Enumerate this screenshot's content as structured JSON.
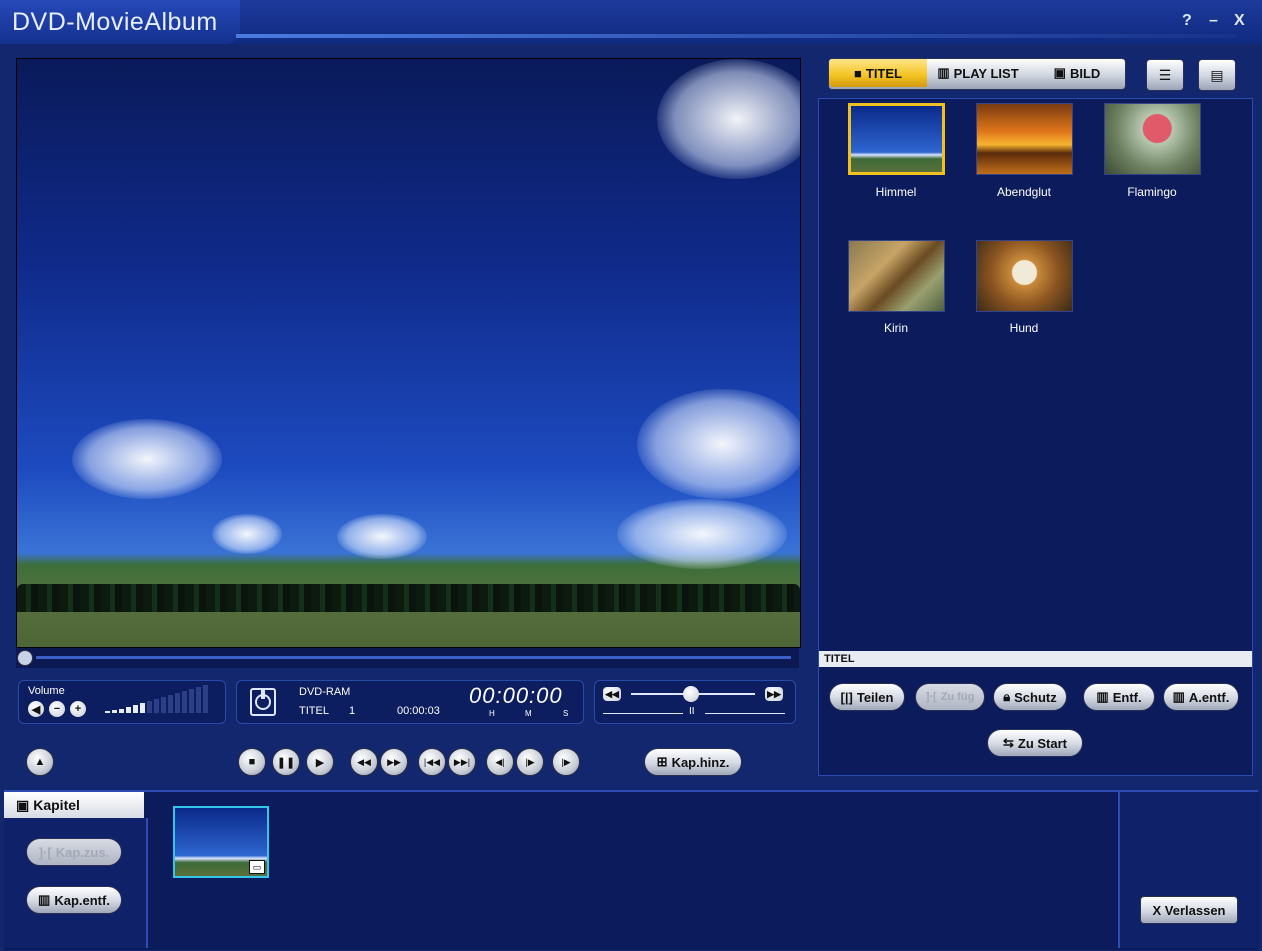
{
  "window": {
    "title": "DVD-MovieAlbum",
    "help": "?",
    "minimize": "–",
    "close": "X"
  },
  "tabs": {
    "titel": "TITEL",
    "playlist": "PLAY LIST",
    "bild": "BILD"
  },
  "thumbnails": [
    {
      "label": "Himmel",
      "selected": true
    },
    {
      "label": "Abendglut",
      "selected": false
    },
    {
      "label": "Flamingo",
      "selected": false
    },
    {
      "label": "Kirin",
      "selected": false
    },
    {
      "label": "Hund",
      "selected": false
    }
  ],
  "titel_section_label": "TITEL",
  "title_buttons": {
    "teilen": "Teilen",
    "zufueg": "Zu füg",
    "schutz": "Schutz",
    "entf": "Entf.",
    "aentf": "A.entf.",
    "zustart": "Zu Start"
  },
  "volume": {
    "label": "Volume"
  },
  "disc": {
    "type": "DVD-RAM",
    "titel_label": "TITEL",
    "titel_number": "1",
    "duration": "00:00:03",
    "timecode": "00:00:00",
    "unit_h": "H",
    "unit_m": "M",
    "unit_s": "S"
  },
  "speed": {
    "pause_mark": "II"
  },
  "kap_hinz": "Kap.hinz.",
  "kapitel": {
    "label": "Kapitel",
    "kap_zus": "Kap.zus.",
    "kap_entf": "Kap.entf."
  },
  "exit": "X Verlassen"
}
